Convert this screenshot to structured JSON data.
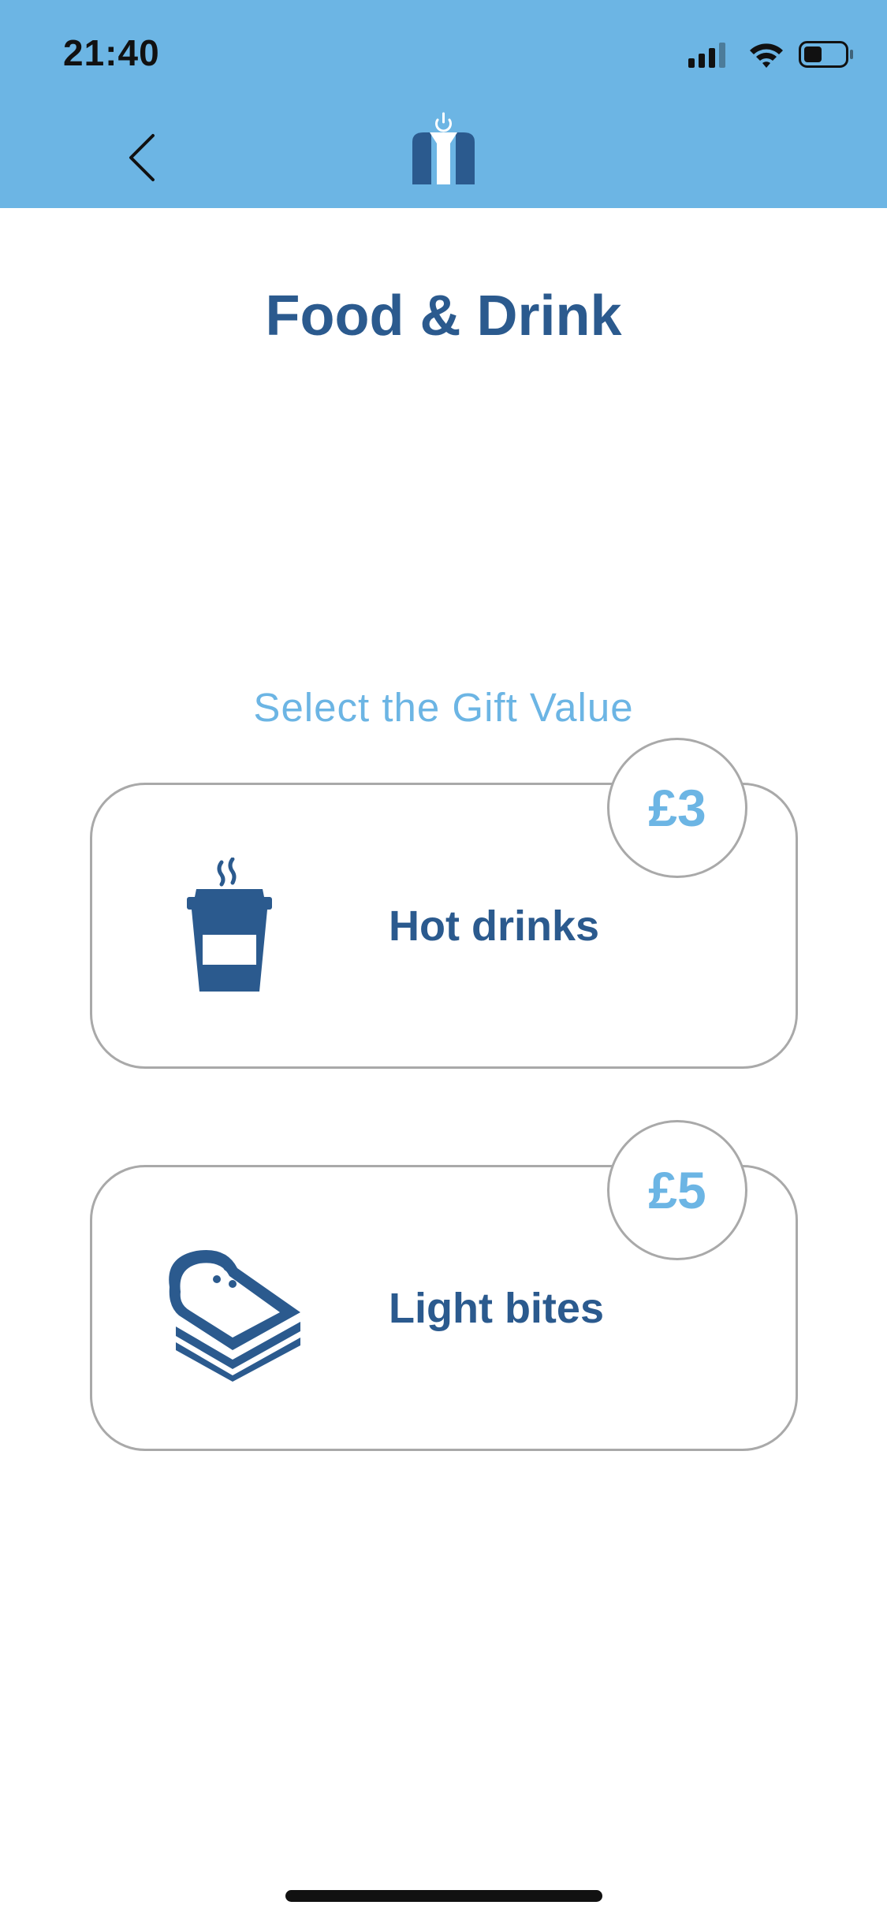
{
  "status_bar": {
    "time": "21:40",
    "icons": [
      "signal-icon",
      "wifi-icon",
      "battery-icon"
    ]
  },
  "nav": {
    "back_icon": "chevron-left-icon",
    "logo_icon": "brand-logo-icon"
  },
  "page": {
    "title": "Food & Drink",
    "subtitle": "Select the Gift Value"
  },
  "gifts": [
    {
      "label": "Hot drinks",
      "price": "£3",
      "icon": "coffee-cup-icon"
    },
    {
      "label": "Light bites",
      "price": "£5",
      "icon": "sandwich-icon"
    }
  ],
  "colors": {
    "header": "#6cb5e4",
    "primary": "#2b5a8e",
    "accent": "#6cb5e4",
    "border": "#a9a9a9"
  }
}
